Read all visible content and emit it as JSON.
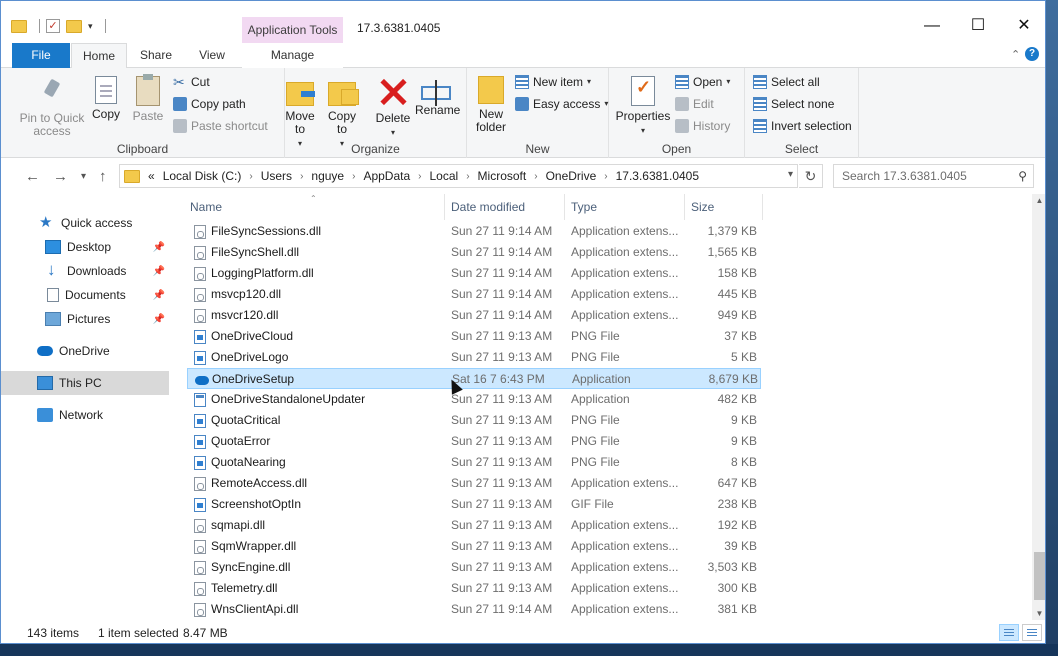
{
  "window": {
    "title": "17.3.6381.0405",
    "context_tab": "Application Tools",
    "minimize": "—",
    "maximize": "☐",
    "close": "✕"
  },
  "tabs": {
    "file": "File",
    "home": "Home",
    "share": "Share",
    "view": "View",
    "manage": "Manage"
  },
  "ribbon": {
    "clipboard": {
      "label": "Clipboard",
      "pin": "Pin to Quick access",
      "copy": "Copy",
      "paste": "Paste",
      "cut": "Cut",
      "copy_path": "Copy path",
      "paste_shortcut": "Paste shortcut"
    },
    "organize": {
      "label": "Organize",
      "move_to": "Move to",
      "copy_to": "Copy to",
      "delete": "Delete",
      "rename": "Rename"
    },
    "new": {
      "label": "New",
      "new_folder": "New folder",
      "new_item": "New item",
      "easy_access": "Easy access"
    },
    "open": {
      "label": "Open",
      "properties": "Properties",
      "open": "Open",
      "edit": "Edit",
      "history": "History"
    },
    "select": {
      "label": "Select",
      "select_all": "Select all",
      "select_none": "Select none",
      "invert": "Invert selection"
    }
  },
  "address": {
    "prefix": "«",
    "crumbs": [
      "Local Disk (C:)",
      "Users",
      "nguye",
      "AppData",
      "Local",
      "Microsoft",
      "OneDrive",
      "17.3.6381.0405"
    ],
    "search_placeholder": "Search 17.3.6381.0405"
  },
  "nav": {
    "quick_access": "Quick access",
    "desktop": "Desktop",
    "downloads": "Downloads",
    "documents": "Documents",
    "pictures": "Pictures",
    "onedrive": "OneDrive",
    "this_pc": "This PC",
    "network": "Network"
  },
  "columns": {
    "name": "Name",
    "date": "Date modified",
    "type": "Type",
    "size": "Size"
  },
  "files": [
    {
      "name": "FileSyncSessions.dll",
      "date": "Sun 27 11 9:14 AM",
      "type": "Application extens...",
      "size": "1,379 KB",
      "icon": "dll-icon"
    },
    {
      "name": "FileSyncShell.dll",
      "date": "Sun 27 11 9:14 AM",
      "type": "Application extens...",
      "size": "1,565 KB",
      "icon": "dll-icon"
    },
    {
      "name": "LoggingPlatform.dll",
      "date": "Sun 27 11 9:14 AM",
      "type": "Application extens...",
      "size": "158 KB",
      "icon": "dll-icon"
    },
    {
      "name": "msvcp120.dll",
      "date": "Sun 27 11 9:14 AM",
      "type": "Application extens...",
      "size": "445 KB",
      "icon": "dll-icon"
    },
    {
      "name": "msvcr120.dll",
      "date": "Sun 27 11 9:14 AM",
      "type": "Application extens...",
      "size": "949 KB",
      "icon": "dll-icon"
    },
    {
      "name": "OneDriveCloud",
      "date": "Sun 27 11 9:13 AM",
      "type": "PNG File",
      "size": "37 KB",
      "icon": "png-icon"
    },
    {
      "name": "OneDriveLogo",
      "date": "Sun 27 11 9:13 AM",
      "type": "PNG File",
      "size": "5 KB",
      "icon": "png-icon"
    },
    {
      "name": "OneDriveSetup",
      "date": "Sat 16 7 6:43 PM",
      "type": "Application",
      "size": "8,679 KB",
      "icon": "onedrive-app-icon",
      "selected": true
    },
    {
      "name": "OneDriveStandaloneUpdater",
      "date": "Sun 27 11 9:13 AM",
      "type": "Application",
      "size": "482 KB",
      "icon": "exe-icon"
    },
    {
      "name": "QuotaCritical",
      "date": "Sun 27 11 9:13 AM",
      "type": "PNG File",
      "size": "9 KB",
      "icon": "png-icon"
    },
    {
      "name": "QuotaError",
      "date": "Sun 27 11 9:13 AM",
      "type": "PNG File",
      "size": "9 KB",
      "icon": "png-icon"
    },
    {
      "name": "QuotaNearing",
      "date": "Sun 27 11 9:13 AM",
      "type": "PNG File",
      "size": "8 KB",
      "icon": "png-icon"
    },
    {
      "name": "RemoteAccess.dll",
      "date": "Sun 27 11 9:13 AM",
      "type": "Application extens...",
      "size": "647 KB",
      "icon": "dll-icon"
    },
    {
      "name": "ScreenshotOptIn",
      "date": "Sun 27 11 9:13 AM",
      "type": "GIF File",
      "size": "238 KB",
      "icon": "png-icon"
    },
    {
      "name": "sqmapi.dll",
      "date": "Sun 27 11 9:13 AM",
      "type": "Application extens...",
      "size": "192 KB",
      "icon": "dll-icon"
    },
    {
      "name": "SqmWrapper.dll",
      "date": "Sun 27 11 9:13 AM",
      "type": "Application extens...",
      "size": "39 KB",
      "icon": "dll-icon"
    },
    {
      "name": "SyncEngine.dll",
      "date": "Sun 27 11 9:13 AM",
      "type": "Application extens...",
      "size": "3,503 KB",
      "icon": "dll-icon"
    },
    {
      "name": "Telemetry.dll",
      "date": "Sun 27 11 9:13 AM",
      "type": "Application extens...",
      "size": "300 KB",
      "icon": "dll-icon"
    },
    {
      "name": "WnsClientApi.dll",
      "date": "Sun 27 11 9:14 AM",
      "type": "Application extens...",
      "size": "381 KB",
      "icon": "dll-icon"
    }
  ],
  "status": {
    "items": "143 items",
    "selected": "1 item selected",
    "size": "8.47 MB"
  }
}
